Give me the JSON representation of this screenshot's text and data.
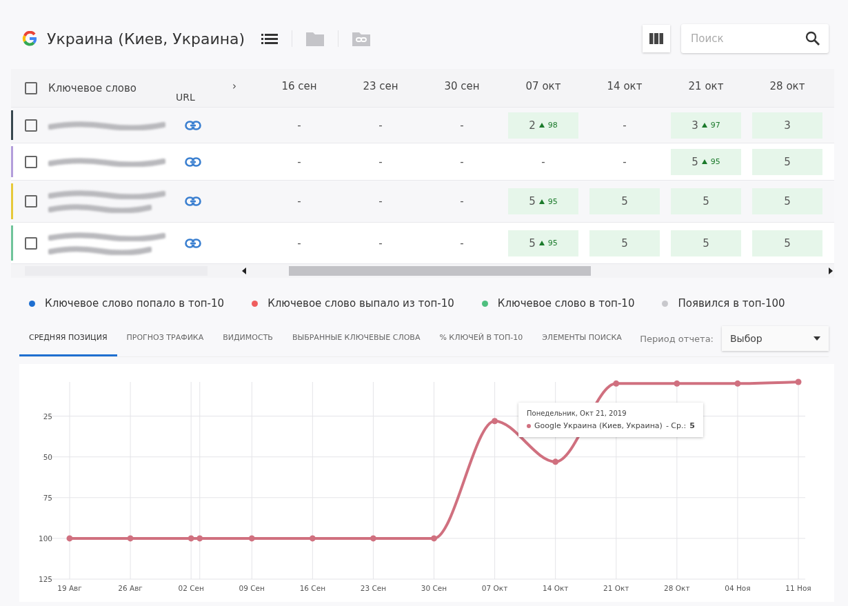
{
  "header": {
    "title": "Украина (Киев, Украина)",
    "icons": [
      {
        "kind": "list",
        "disabled": false
      },
      {
        "kind": "folder",
        "disabled": true
      },
      {
        "kind": "link-folder",
        "disabled": true
      }
    ],
    "search": {
      "placeholder": "Поиск"
    }
  },
  "table": {
    "select_all": {
      "checked": false
    },
    "columns": {
      "keyword": "Ключевое слово",
      "url": "URL",
      "partial": "›",
      "dates": [
        "16 сен",
        "23 сен",
        "30 сен",
        "07 окт",
        "14 окт",
        "21 окт",
        "28 окт"
      ]
    },
    "rows": [
      {
        "color": "#37474f",
        "checked": false,
        "keyword_wrapped": false,
        "cells": [
          {
            "text": "-",
            "highlighted": false
          },
          {
            "text": "-",
            "highlighted": false
          },
          {
            "text": "-",
            "highlighted": false
          },
          {
            "text": "2",
            "change": "98",
            "highlighted": true
          },
          {
            "text": "-",
            "highlighted": false
          },
          {
            "text": "3",
            "change": "97",
            "highlighted": true
          },
          {
            "text": "3",
            "highlighted": true
          }
        ]
      },
      {
        "color": "#b39ddb",
        "checked": false,
        "keyword_wrapped": false,
        "cells": [
          {
            "text": "-",
            "highlighted": false
          },
          {
            "text": "-",
            "highlighted": false
          },
          {
            "text": "-",
            "highlighted": false
          },
          {
            "text": "-",
            "highlighted": false
          },
          {
            "text": "-",
            "highlighted": false
          },
          {
            "text": "5",
            "change": "95",
            "highlighted": true
          },
          {
            "text": "5",
            "highlighted": true
          }
        ]
      },
      {
        "color": "#e6c93a",
        "checked": false,
        "keyword_wrapped": true,
        "cells": [
          {
            "text": "-",
            "highlighted": false
          },
          {
            "text": "-",
            "highlighted": false
          },
          {
            "text": "-",
            "highlighted": false
          },
          {
            "text": "5",
            "change": "95",
            "highlighted": true
          },
          {
            "text": "5",
            "highlighted": true
          },
          {
            "text": "5",
            "highlighted": true
          },
          {
            "text": "5",
            "highlighted": true
          }
        ]
      },
      {
        "color": "#6fc49a",
        "checked": false,
        "keyword_wrapped": true,
        "cells": [
          {
            "text": "-",
            "highlighted": false
          },
          {
            "text": "-",
            "highlighted": false
          },
          {
            "text": "-",
            "highlighted": false
          },
          {
            "text": "5",
            "change": "95",
            "highlighted": true
          },
          {
            "text": "5",
            "highlighted": true
          },
          {
            "text": "5",
            "highlighted": true
          },
          {
            "text": "5",
            "highlighted": true
          }
        ]
      }
    ]
  },
  "legend": [
    {
      "label": "Ключевое слово попало в топ-10",
      "color": "#1e6fd0"
    },
    {
      "label": "Ключевое слово выпало из топ-10",
      "color": "#ef5e5e"
    },
    {
      "label": "Ключевое слово в топ-10",
      "color": "#4fbf7f"
    },
    {
      "label": "Появился в топ-100",
      "color": "#c8c8cc"
    }
  ],
  "tabs": [
    {
      "label": "СРЕДНЯЯ ПОЗИЦИЯ",
      "selected": true
    },
    {
      "label": "ПРОГНОЗ ТРАФИКА",
      "selected": false
    },
    {
      "label": "ВИДИМОСТЬ",
      "selected": false
    },
    {
      "label": "ВЫБРАННЫЕ КЛЮЧЕВЫЕ СЛОВА",
      "selected": false
    },
    {
      "label": "% КЛЮЧЕЙ В ТОП-10",
      "selected": false
    },
    {
      "label": "ЭЛЕМЕНТЫ ПОИСКА",
      "selected": false
    }
  ],
  "period": {
    "label": "Период отчета:",
    "value": "Выбор"
  },
  "chart": {
    "chart_data": {
      "type": "line",
      "x": [
        "2019-08-19",
        "2019-08-26",
        "2019-09-02",
        "2019-09-03",
        "2019-09-09",
        "2019-09-16",
        "2019-09-23",
        "2019-09-30",
        "2019-10-07",
        "2019-10-14",
        "2019-10-21",
        "2019-10-28",
        "2019-11-04",
        "2019-11-11"
      ],
      "xlim": [
        "2019-08-19",
        "2019-11-11"
      ],
      "ylim": [
        125,
        4
      ],
      "grid": true,
      "xticks": [
        {
          "value": "2019-08-19",
          "label": "19 Авг"
        },
        {
          "value": "2019-08-26",
          "label": "26 Авг"
        },
        {
          "value": "2019-09-02",
          "label": "02 Сен"
        },
        {
          "value": "2019-09-09",
          "label": "09 Сен"
        },
        {
          "value": "2019-09-16",
          "label": "16 Сен"
        },
        {
          "value": "2019-09-23",
          "label": "23 Сен"
        },
        {
          "value": "2019-09-30",
          "label": "30 Сен"
        },
        {
          "value": "2019-10-07",
          "label": "07 Окт"
        },
        {
          "value": "2019-10-14",
          "label": "14 Окт"
        },
        {
          "value": "2019-10-21",
          "label": "21 Окт"
        },
        {
          "value": "2019-10-28",
          "label": "28 Окт"
        },
        {
          "value": "2019-11-04",
          "label": "04 Ноя"
        },
        {
          "value": "2019-11-11",
          "label": "11 Ноя"
        }
      ],
      "yticks": [
        25,
        50,
        75,
        100,
        125
      ],
      "series": [
        {
          "name": "Google Украина (Киев, Украина)",
          "color": "#d0707f",
          "marker": "circle",
          "values": [
            100,
            100,
            100,
            100,
            100,
            100,
            100,
            100,
            28,
            53,
            5,
            5,
            5,
            4
          ]
        }
      ]
    },
    "tooltip": {
      "date": "Понедельник, Окт 21, 2019",
      "value_label": "- Ср.:",
      "value": "5"
    }
  }
}
